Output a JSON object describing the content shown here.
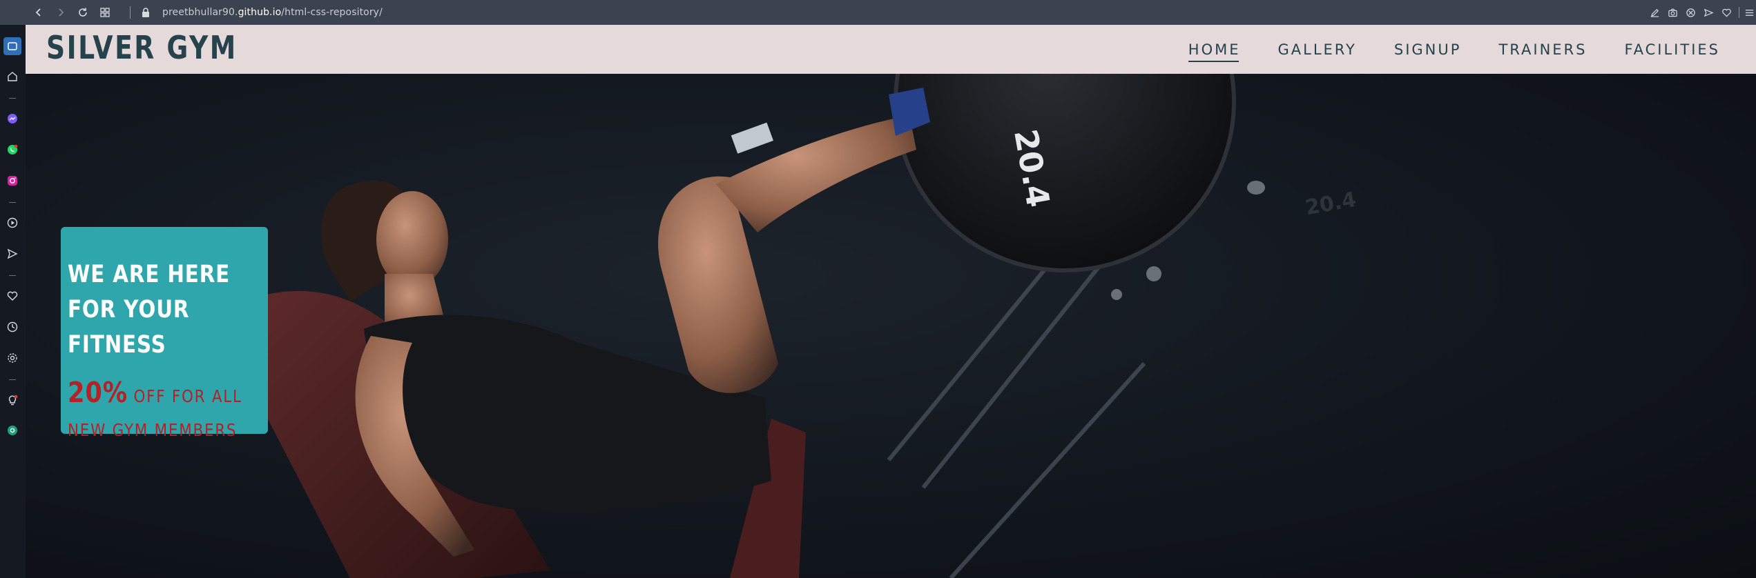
{
  "browser": {
    "url_prefix": "preetbhullar90.",
    "url_domain": "github.io",
    "url_path": "/html-css-repository/"
  },
  "site": {
    "logo": "SILVER GYM",
    "nav": [
      {
        "label": "HOME",
        "active": true
      },
      {
        "label": "GALLERY",
        "active": false
      },
      {
        "label": "SIGNUP",
        "active": false
      },
      {
        "label": "TRAINERS",
        "active": false
      },
      {
        "label": "FACILITIES",
        "active": false
      }
    ]
  },
  "hero": {
    "promo_title": "WE ARE HERE FOR YOUR FITNESS",
    "promo_percent": "20%",
    "promo_text_line1": " OFF FOR ALL",
    "promo_text_line2": "NEW GYM MEMBERS",
    "plate_label": "20.4",
    "plate_label_small": "20.4"
  },
  "colors": {
    "header_bg": "#e5d9d9",
    "brand_text": "#26424c",
    "promo_bg": "#2fa6ac",
    "promo_accent": "#b22227"
  }
}
